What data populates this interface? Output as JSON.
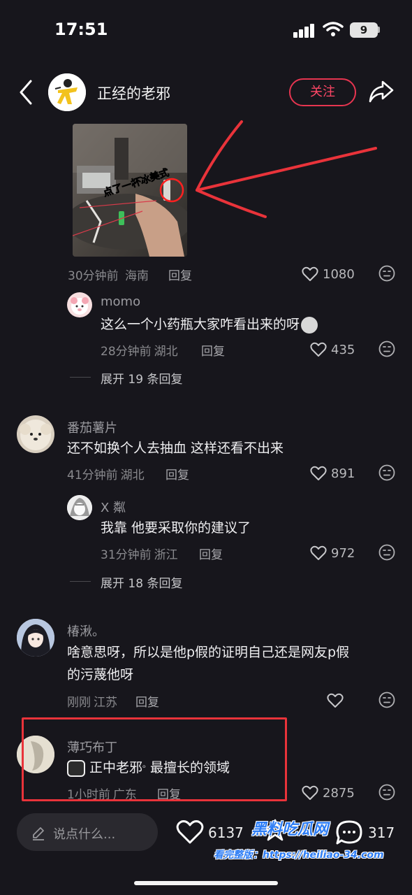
{
  "status_bar": {
    "time": "17:51",
    "battery": "9"
  },
  "header": {
    "author_name": "正经的老邪",
    "follow_label": "关注"
  },
  "top_comment": {
    "image_caption": "点了一杯冰美式",
    "time": "30分钟前",
    "location": "海南",
    "reply_label": "回复",
    "likes": "1080",
    "replies": [
      {
        "name": "momo",
        "text": "这么一个小药瓶大家咋看出来的呀",
        "time": "28分钟前",
        "location": "湖北",
        "reply_label": "回复",
        "likes": "435"
      }
    ],
    "expand_label": "展开 19 条回复"
  },
  "comments": [
    {
      "name": "番茄薯片",
      "text": "还不如换个人去抽血 这样还看不出来",
      "time": "41分钟前",
      "location": "湖北",
      "reply_label": "回复",
      "likes": "891",
      "replies": [
        {
          "name": "X 粼",
          "text": "我靠 他要采取你的建议了",
          "time": "31分钟前",
          "location": "浙江",
          "reply_label": "回复",
          "likes": "972"
        }
      ],
      "expand_label": "展开 18 条回复"
    },
    {
      "name": "椿湫。",
      "text_line1": "啥意思呀，所以是他p假的证明自己还是网友p假",
      "text_line2": "的污蔑他呀",
      "time": "刚刚",
      "location": "江苏",
      "reply_label": "回复",
      "likes": ""
    },
    {
      "name": "薄巧布丁",
      "link_text": "正中老邪",
      "text": "最擅长的领域",
      "time": "1小时前",
      "location": "广东",
      "reply_label": "回复",
      "likes": "2875"
    }
  ],
  "bottom_bar": {
    "placeholder": "说点什么...",
    "likes": "6137",
    "comments": "317"
  },
  "watermark": {
    "line1": "黑料吃瓜网",
    "line2": "看完整版：https://heiliao-34.com"
  },
  "colors": {
    "background": "#17161c",
    "accent": "#ff4766",
    "annotation_red": "#e9333a"
  }
}
